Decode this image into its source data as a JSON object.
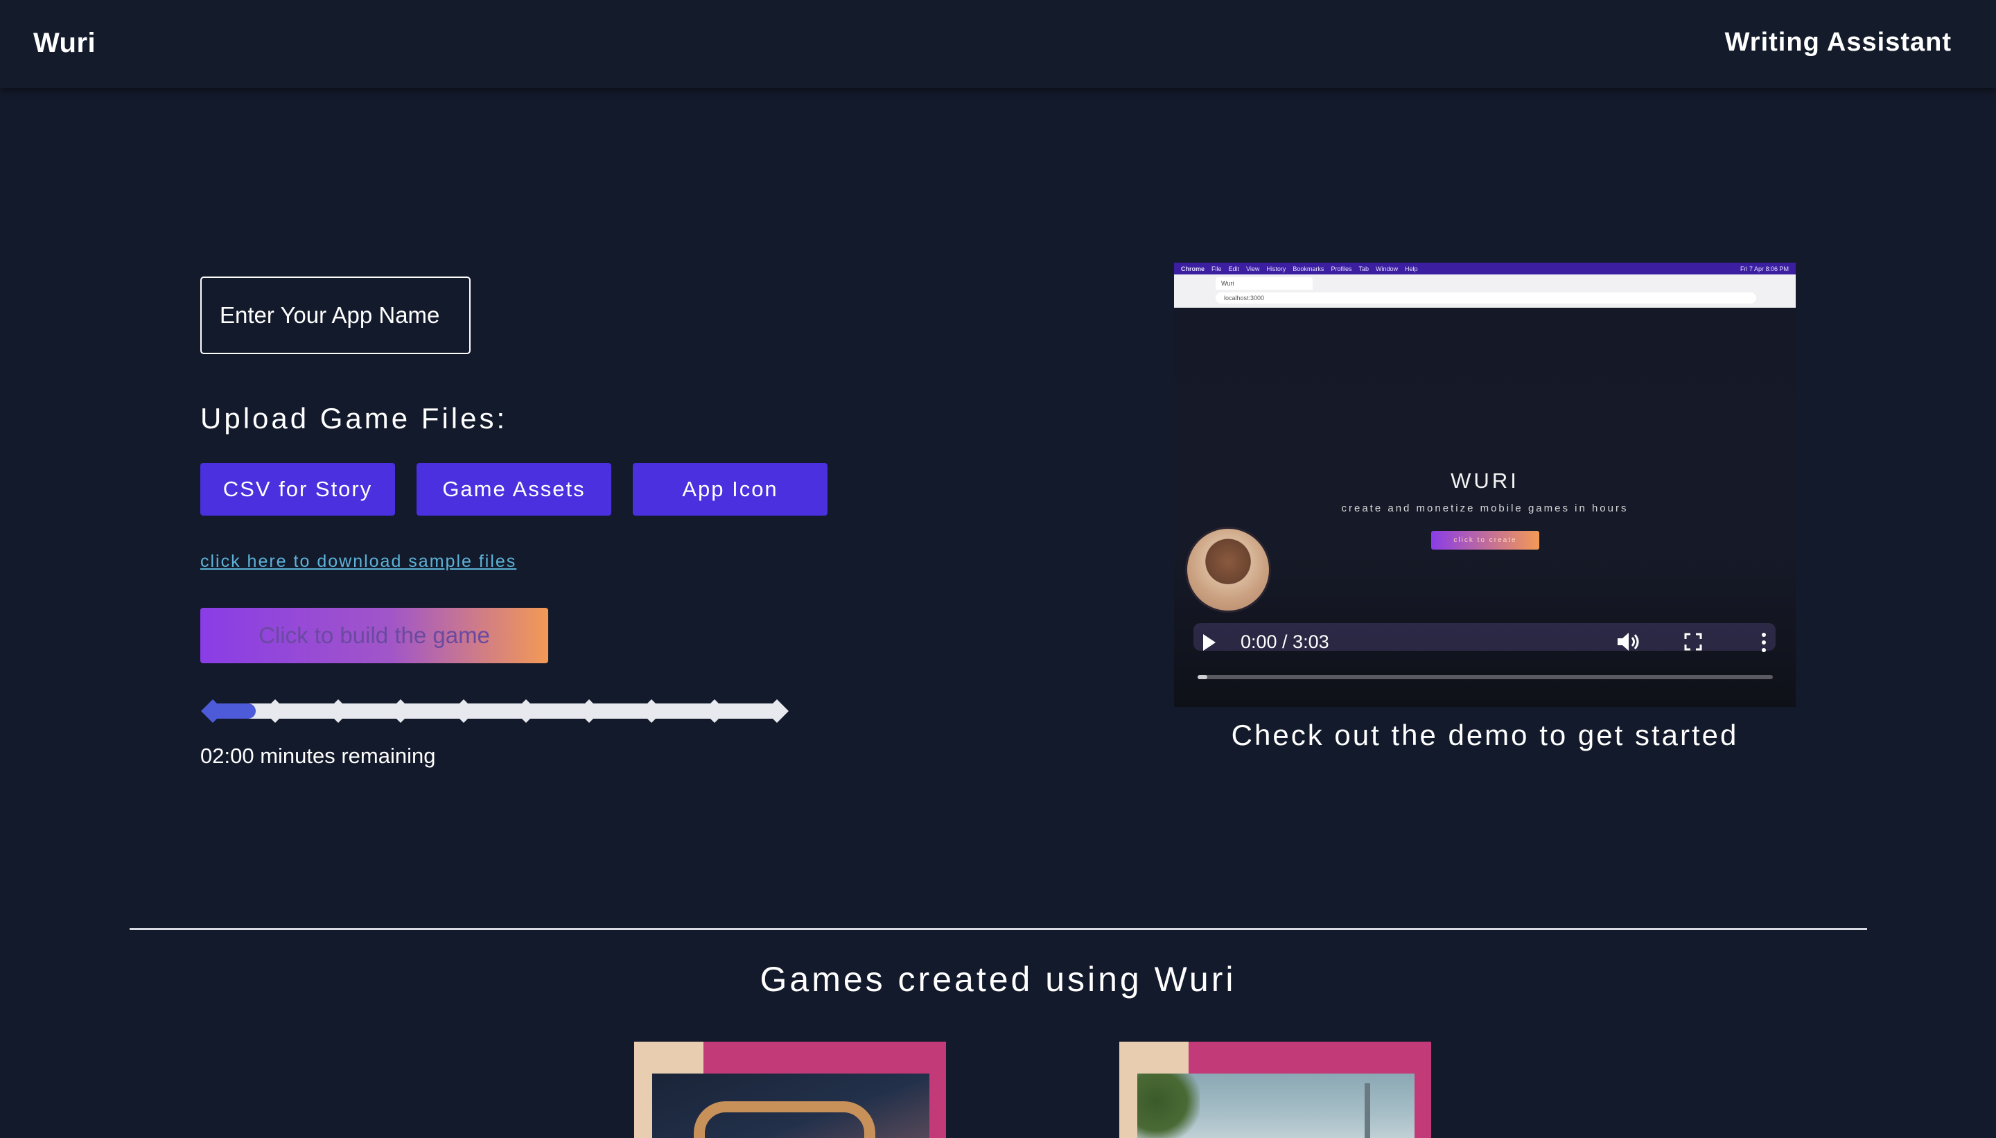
{
  "header": {
    "brand": "Wuri",
    "writing_assistant": "Writing Assistant"
  },
  "form": {
    "app_name_placeholder": "Enter Your App Name",
    "app_name_value": "",
    "upload_heading": "Upload Game Files:",
    "upload_buttons": [
      "CSV for Story",
      "Game Assets",
      "App Icon"
    ],
    "sample_link": "click here to download sample files",
    "build_button": "Click to build the game",
    "progress": {
      "steps": 10,
      "completed_fraction": 0.05
    },
    "time_remaining": "02:00 minutes remaining"
  },
  "demo": {
    "menubar_items": [
      "Chrome",
      "File",
      "Edit",
      "View",
      "History",
      "Bookmarks",
      "Profiles",
      "Tab",
      "Window",
      "Help"
    ],
    "menubar_clock": "Fri 7 Apr 8:06 PM",
    "tab_title": "Wuri",
    "url": "localhost:3000",
    "video_title": "WURI",
    "video_subtitle": "create and monetize mobile games in hours",
    "video_cta": "click to create",
    "time_display": "0:00 / 3:03",
    "caption": "Check out the demo to get started"
  },
  "games": {
    "heading": "Games created using Wuri"
  },
  "colors": {
    "background": "#131a2b",
    "upload_button": "#4a30df",
    "link": "#5db3d8",
    "progress_fill": "#4e5bd8",
    "card_pink": "#c23a78"
  },
  "icons": [
    "play-icon",
    "volume-icon",
    "fullscreen-icon",
    "more-options-icon"
  ]
}
